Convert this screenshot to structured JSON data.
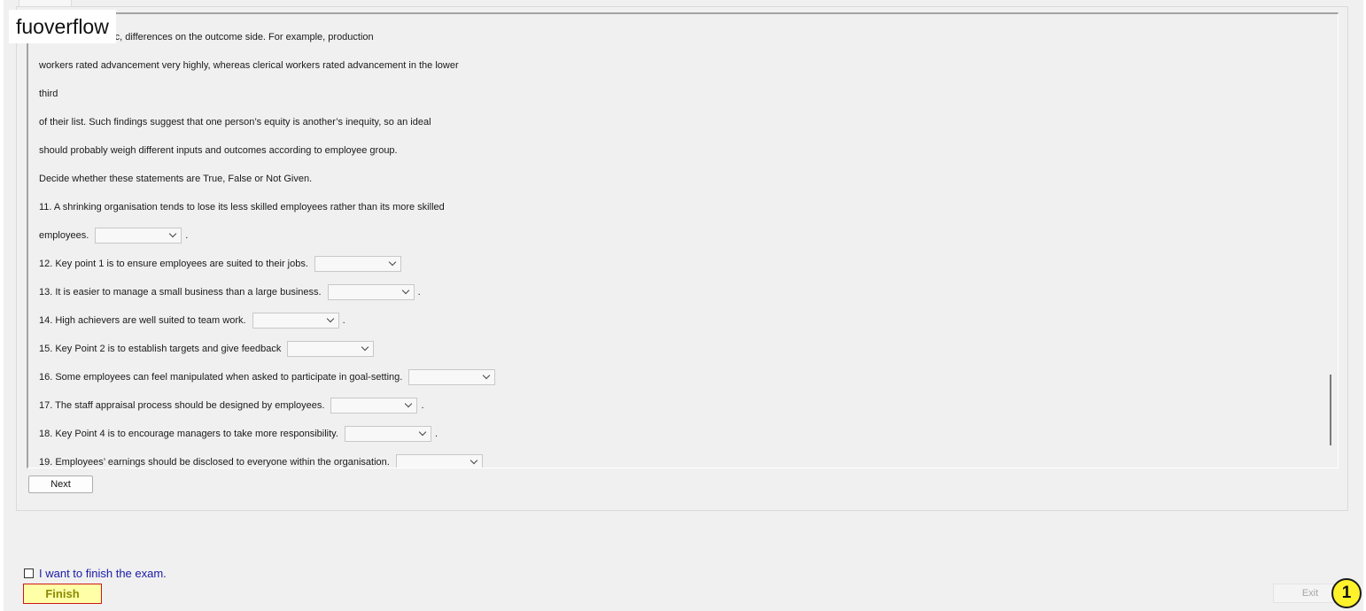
{
  "overlay_label": "fuoverflow",
  "passage_lines": [
    "such less dramatic, differences on the outcome side. For example, production",
    "workers rated advancement very highly, whereas clerical workers rated advancement in the lower",
    "third",
    "of their list. Such findings suggest that one person’s equity is another’s inequity, so an ideal",
    "should probably weigh different inputs and outcomes according to employee group.",
    "Decide whether these statements are True, False or Not Given.",
    "11. A shrinking organisation tends to lose its less skilled employees rather than its more skilled"
  ],
  "questions": [
    {
      "text": "employees.",
      "answer": "",
      "dot": "."
    },
    {
      "text": "12. Key point 1 is to ensure employees are suited to their jobs.",
      "answer": "",
      "dot": ""
    },
    {
      "text": "13. It is easier to manage a small business than a large business.",
      "answer": "",
      "dot": "."
    },
    {
      "text": "14. High achievers are well suited to team work.",
      "answer": "",
      "dot": "."
    },
    {
      "text": "15. Key Point 2 is to establish targets and give feedback",
      "answer": "",
      "dot": ""
    },
    {
      "text": "16. Some employees can feel manipulated when asked to participate in goal-setting.",
      "answer": "",
      "dot": ""
    },
    {
      "text": "17. The staff appraisal process should be designed by employees.",
      "answer": "",
      "dot": "."
    },
    {
      "text": "18. Key Point 4 is to encourage managers to take more responsibility.",
      "answer": "",
      "dot": "."
    },
    {
      "text": "19. Employees’ earnings should be disclosed to everyone within the organisation.",
      "answer": "",
      "dot": ""
    }
  ],
  "next_label": "Next",
  "finish_checkbox_label": "I want to finish the exam.",
  "finish_label": "Finish",
  "exit_label": "Exit",
  "badge_number": "1",
  "colors": {
    "finish_bg": "#ffffa8",
    "finish_border": "#d01818",
    "badge": "#fff22b",
    "check_label": "#1a1aa8"
  }
}
